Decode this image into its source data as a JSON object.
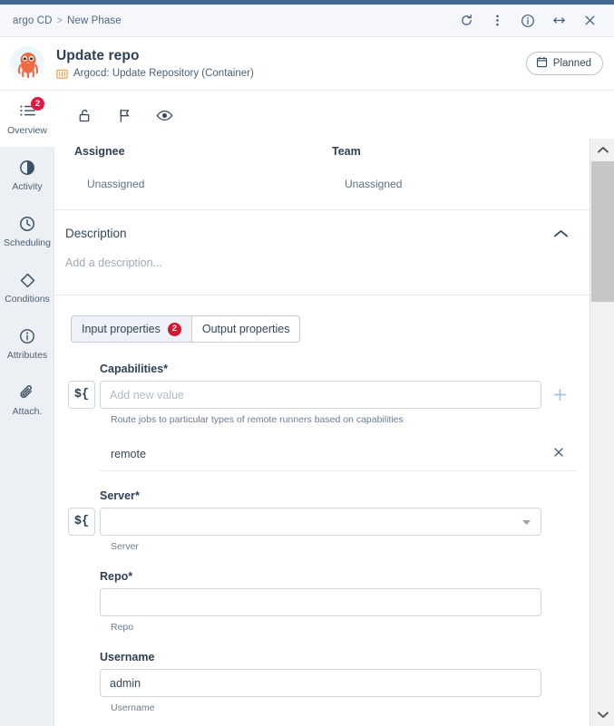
{
  "window": {
    "breadcrumb": {
      "root": "argo CD",
      "separator": ">",
      "current": "New Phase"
    },
    "actions": [
      {
        "name": "refresh",
        "label": "Refresh"
      },
      {
        "name": "more-options",
        "label": "More options"
      },
      {
        "name": "info",
        "label": "Info"
      },
      {
        "name": "expand",
        "label": "Expand"
      },
      {
        "name": "close",
        "label": "Close"
      }
    ],
    "accent_color": "#3f6a94"
  },
  "header": {
    "avatar_name": "octopus-avatar",
    "title": "Update repo",
    "subtitle": "Argocd: Update Repository (Container)",
    "subtitle_icon": "container-icon",
    "status": {
      "label": "Planned",
      "icon": "calendar-icon"
    }
  },
  "sidebar": {
    "items": [
      {
        "label": "Overview",
        "icon": "list-icon",
        "badge": "2",
        "active": true
      },
      {
        "label": "Activity",
        "icon": "pie-chart-icon",
        "badge": "",
        "active": false
      },
      {
        "label": "Scheduling",
        "icon": "clock-icon",
        "badge": "",
        "active": false
      },
      {
        "label": "Conditions",
        "icon": "diamond-icon",
        "badge": "",
        "active": false
      },
      {
        "label": "Attributes",
        "icon": "info-icon",
        "badge": "",
        "active": false
      },
      {
        "label": "Attach.",
        "icon": "paperclip-icon",
        "badge": "",
        "active": false
      }
    ]
  },
  "toolbar": {
    "icons": [
      {
        "name": "unlock-icon",
        "label": "Lock"
      },
      {
        "name": "flag-icon",
        "label": "Flag"
      },
      {
        "name": "eye-icon",
        "label": "Watch"
      }
    ]
  },
  "meta": {
    "assignee_label": "Assignee",
    "assignee_value": "Unassigned",
    "team_label": "Team",
    "team_value": "Unassigned"
  },
  "description": {
    "title": "Description",
    "placeholder": "Add a description...",
    "collapse_icon": "chevron-up-icon"
  },
  "tabs": [
    {
      "label": "Input properties",
      "badge": "2",
      "active": true
    },
    {
      "label": "Output properties",
      "badge": "",
      "active": false
    }
  ],
  "form": {
    "capabilities": {
      "label": "Capabilities",
      "required": "*",
      "placeholder": "Add new value",
      "value": "",
      "help": "Route jobs to particular types of remote runners based on capabilities",
      "var_button": "${",
      "add_button": "add-icon",
      "chips": [
        {
          "label": "remote",
          "remove_icon": "close-icon"
        }
      ]
    },
    "server": {
      "label": "Server",
      "required": "*",
      "value": "",
      "help": "Server",
      "var_button": "${",
      "dropdown_icon": "chevron-down-icon"
    },
    "repo": {
      "label": "Repo",
      "required": "*",
      "value": "",
      "help": "Repo"
    },
    "username": {
      "label": "Username",
      "required": "",
      "value": "admin",
      "help": "Username"
    }
  },
  "scrollbar": {
    "up_icon": "chevron-up-icon",
    "down_icon": "chevron-down-icon"
  }
}
